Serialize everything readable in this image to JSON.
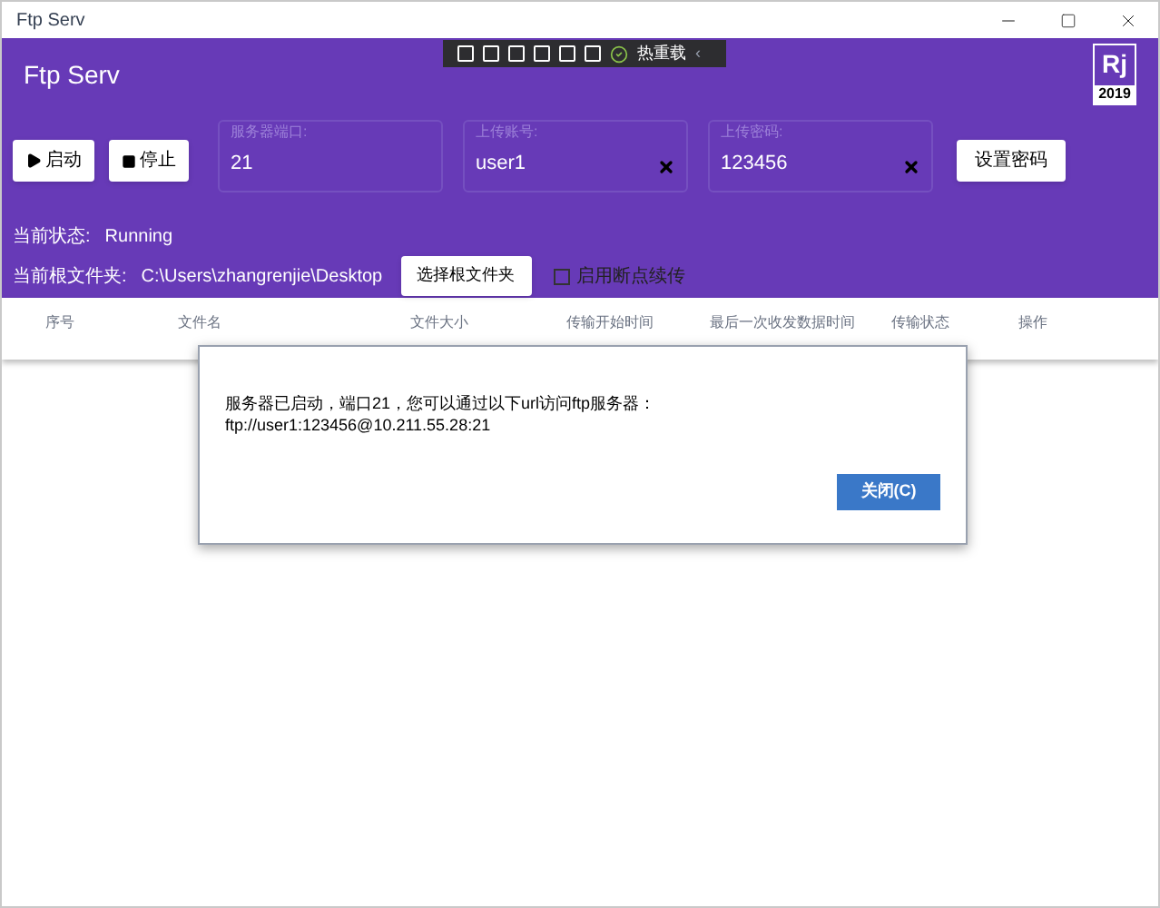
{
  "window": {
    "title": "Ftp Serv"
  },
  "header": {
    "title": "Ftp Serv",
    "logo": {
      "letters": "Rj",
      "year": "2019"
    }
  },
  "debug_toolbar": {
    "label": "热重载",
    "collapse": "‹"
  },
  "buttons": [
    {
      "label": "启动",
      "kind": "play"
    },
    {
      "label": "停止",
      "kind": "stop"
    }
  ],
  "fields": [
    {
      "label": "服务器端口:",
      "value": "21",
      "clearable": false
    },
    {
      "label": "上传账号:",
      "value": "user1",
      "clearable": true
    },
    {
      "label": "上传密码:",
      "value": "123456",
      "clearable": true
    }
  ],
  "set_password_button": "设置密码",
  "status": {
    "label": "当前状态:",
    "value": "Running"
  },
  "root_folder": {
    "label": "当前根文件夹:",
    "value": "C:\\Users\\zhangrenjie\\Desktop",
    "button": "选择根文件夹"
  },
  "resume_checkbox": {
    "label": "启用断点续传",
    "checked": false
  },
  "table": {
    "columns": [
      "序号",
      "文件名",
      "文件大小",
      "传输开始时间",
      "最后一次收发数据时间",
      "传输状态",
      "操作"
    ]
  },
  "dialog": {
    "message": "服务器已启动，端口21，您可以通过以下url访问ftp服务器：",
    "url": "ftp://user1:123456@10.211.55.28:21",
    "button": "关闭(C)"
  }
}
